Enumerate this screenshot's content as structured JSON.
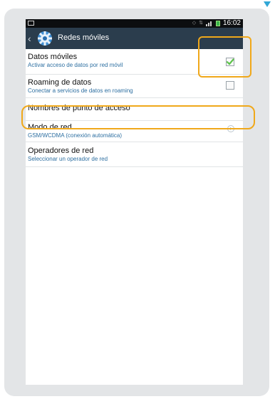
{
  "status_bar": {
    "time": "16:02",
    "icons": [
      "image-icon",
      "network-icon",
      "data-arrows-icon",
      "signal-icon",
      "battery-icon"
    ]
  },
  "action_bar": {
    "back_icon": "chevron-left-icon",
    "app_icon": "gear-icon",
    "title": "Redes móviles"
  },
  "settings": [
    {
      "title": "Datos móviles",
      "subtitle": "Activar acceso de datos por red móvil",
      "control": "checkbox",
      "checked": true
    },
    {
      "title": "Roaming de datos",
      "subtitle": "Conectar a servicios de datos en roaming",
      "control": "checkbox",
      "checked": false
    },
    {
      "title": "Nombres de punto de acceso",
      "subtitle": "",
      "control": "none"
    },
    {
      "title": "Modo de red",
      "subtitle": "GSM/WCDMA (conexión automática)",
      "control": "chevron"
    },
    {
      "title": "Operadores de red",
      "subtitle": "Seleccionar un operador de red",
      "control": "none"
    }
  ],
  "colors": {
    "action_bar": "#2b3d4d",
    "highlight": "#f0a81a",
    "subtitle": "#2d6fa1",
    "check": "#5cc24a"
  }
}
